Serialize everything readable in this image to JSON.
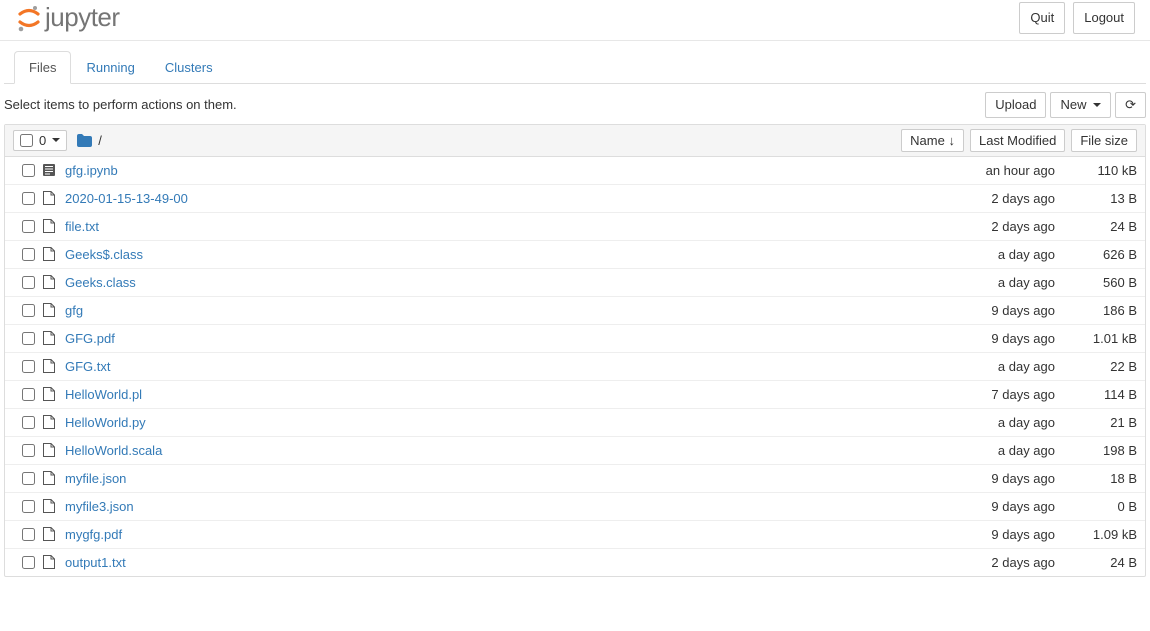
{
  "header": {
    "logo_text": "jupyter",
    "quit_label": "Quit",
    "logout_label": "Logout"
  },
  "tabs": {
    "files": "Files",
    "running": "Running",
    "clusters": "Clusters"
  },
  "toolbar": {
    "hint": "Select items to perform actions on them.",
    "upload_label": "Upload",
    "new_label": "New"
  },
  "list_header": {
    "select_count": "0",
    "breadcrumb_root": "/",
    "sort_name": "Name",
    "sort_modified": "Last Modified",
    "sort_size": "File size"
  },
  "files": [
    {
      "name": "gfg.ipynb",
      "modified": "an hour ago",
      "size": "110 kB",
      "type": "notebook"
    },
    {
      "name": "2020-01-15-13-49-00",
      "modified": "2 days ago",
      "size": "13 B",
      "type": "file"
    },
    {
      "name": "file.txt",
      "modified": "2 days ago",
      "size": "24 B",
      "type": "file"
    },
    {
      "name": "Geeks$.class",
      "modified": "a day ago",
      "size": "626 B",
      "type": "file"
    },
    {
      "name": "Geeks.class",
      "modified": "a day ago",
      "size": "560 B",
      "type": "file"
    },
    {
      "name": "gfg",
      "modified": "9 days ago",
      "size": "186 B",
      "type": "file"
    },
    {
      "name": "GFG.pdf",
      "modified": "9 days ago",
      "size": "1.01 kB",
      "type": "file"
    },
    {
      "name": "GFG.txt",
      "modified": "a day ago",
      "size": "22 B",
      "type": "file"
    },
    {
      "name": "HelloWorld.pl",
      "modified": "7 days ago",
      "size": "114 B",
      "type": "file"
    },
    {
      "name": "HelloWorld.py",
      "modified": "a day ago",
      "size": "21 B",
      "type": "file"
    },
    {
      "name": "HelloWorld.scala",
      "modified": "a day ago",
      "size": "198 B",
      "type": "file"
    },
    {
      "name": "myfile.json",
      "modified": "9 days ago",
      "size": "18 B",
      "type": "file"
    },
    {
      "name": "myfile3.json",
      "modified": "9 days ago",
      "size": "0 B",
      "type": "file"
    },
    {
      "name": "mygfg.pdf",
      "modified": "9 days ago",
      "size": "1.09 kB",
      "type": "file"
    },
    {
      "name": "output1.txt",
      "modified": "2 days ago",
      "size": "24 B",
      "type": "file"
    }
  ]
}
